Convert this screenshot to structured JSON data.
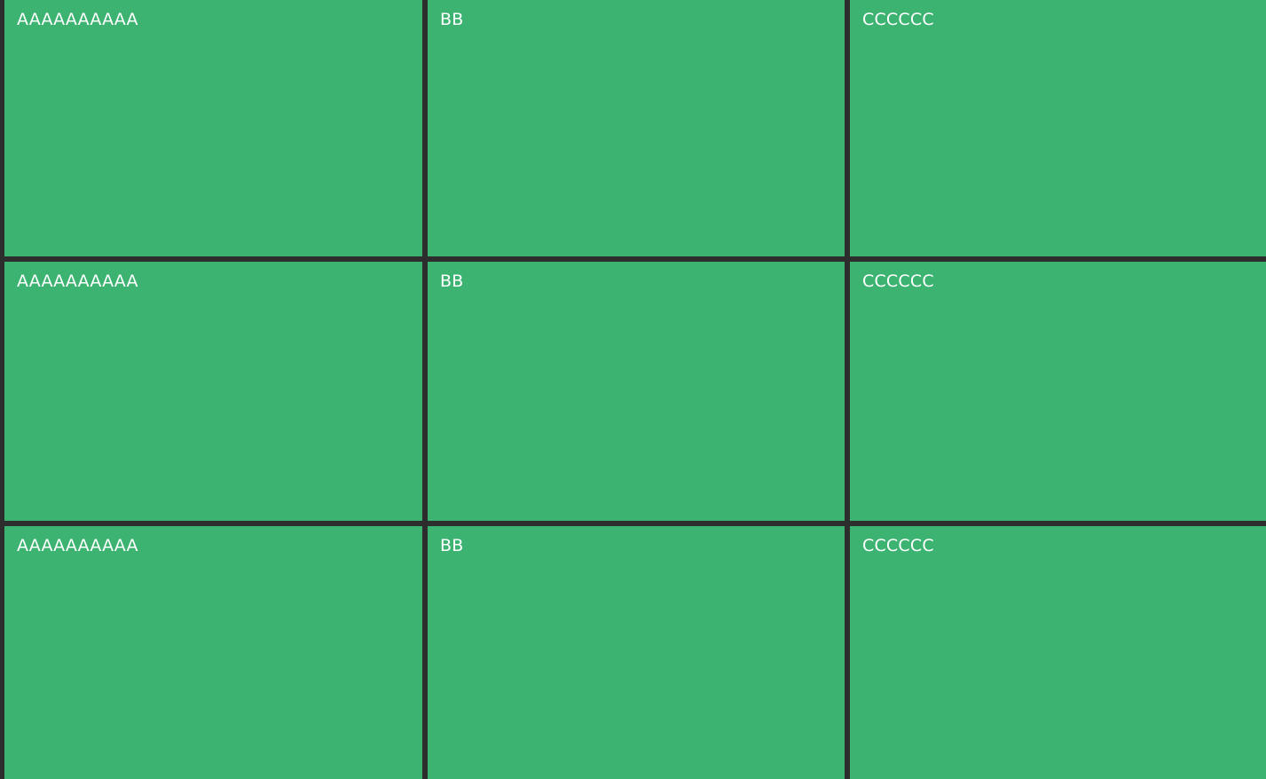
{
  "colors": {
    "cell_background": "#3cb371",
    "grid_lines": "#2d2d2d",
    "label_text": "#ffffff"
  },
  "grid": {
    "rows": [
      {
        "cells": [
          {
            "label": "AAAAAAAAAA"
          },
          {
            "label": "BB"
          },
          {
            "label": "CCCCCC"
          }
        ]
      },
      {
        "cells": [
          {
            "label": "AAAAAAAAAA"
          },
          {
            "label": "BB"
          },
          {
            "label": "CCCCCC"
          }
        ]
      },
      {
        "cells": [
          {
            "label": "AAAAAAAAAA"
          },
          {
            "label": "BB"
          },
          {
            "label": "CCCCCC"
          }
        ]
      }
    ]
  }
}
